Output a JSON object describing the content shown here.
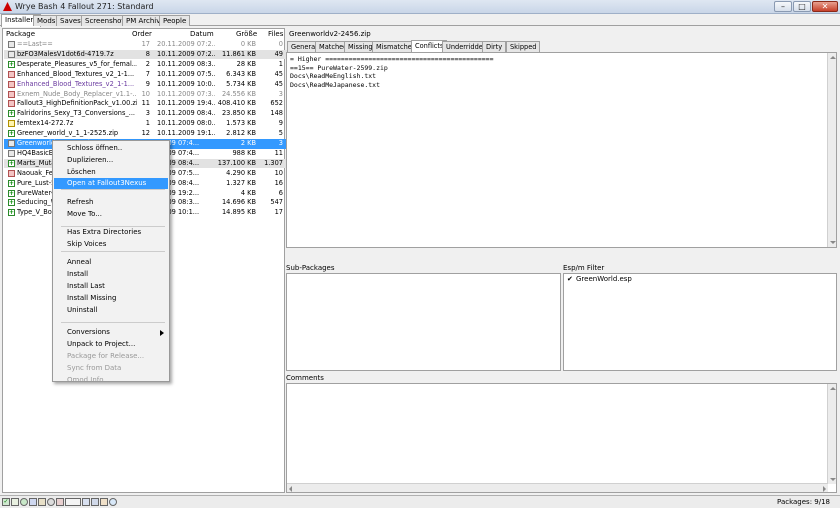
{
  "window": {
    "title": "Wrye Bash 4 Fallout 271: Standard"
  },
  "tabs": [
    "Installers",
    "Mods",
    "Saves",
    "Screenshots",
    "PM Archive",
    "People"
  ],
  "columns": {
    "package": "Package",
    "order": "Order",
    "date": "Datum",
    "size": "Größe",
    "files": "Files"
  },
  "rows": [
    {
      "name": "==Last==",
      "order": "17",
      "date": "20.11.2009 07:2...",
      "size": "0 KB",
      "files": "0",
      "style": "gray",
      "box": "gray"
    },
    {
      "name": "bzFO3MalesV1dot6d-4719.7z",
      "order": "8",
      "date": "10.11.2009 07:2...",
      "size": "11.861 KB",
      "files": "49",
      "style": "grayBg",
      "box": "gray"
    },
    {
      "name": "Desperate_Pleasures_v5_for_femal...",
      "order": "2",
      "date": "10.11.2009 08:3...",
      "size": "28 KB",
      "files": "1",
      "style": "",
      "box": "plus"
    },
    {
      "name": "Enhanced_Blood_Textures_v2_1-1...",
      "order": "7",
      "date": "10.11.2009 07:5...",
      "size": "6.343 KB",
      "files": "45",
      "style": "",
      "box": "red"
    },
    {
      "name": "Enhanced_Blood_Textures_v2_1-1...",
      "order": "9",
      "date": "10.11.2009 10:0...",
      "size": "5.734 KB",
      "files": "45",
      "style": "purple",
      "box": "red"
    },
    {
      "name": "Exnem_Nude_Body_Replacer_v1.1-...",
      "order": "10",
      "date": "10.11.2009 07:3...",
      "size": "24.556 KB",
      "files": "3",
      "style": "gray",
      "box": "red"
    },
    {
      "name": "Fallout3_HighDefinitionPack_v1.00.zip",
      "order": "11",
      "date": "10.11.2009 19:4...",
      "size": "408.410 KB",
      "files": "652",
      "style": "",
      "box": "red"
    },
    {
      "name": "Falridorins_Sexy_T3_Conversions_...",
      "order": "3",
      "date": "10.11.2009 08:4...",
      "size": "23.850 KB",
      "files": "148",
      "style": "",
      "box": "plus"
    },
    {
      "name": "femtex14-272.7z",
      "order": "1",
      "date": "10.11.2009 08:0...",
      "size": "1.573 KB",
      "files": "9",
      "style": "",
      "box": "yel"
    },
    {
      "name": "Greener_world_v_1_1-2525.zip",
      "order": "12",
      "date": "10.11.2009 19:1...",
      "size": "2.812 KB",
      "files": "5",
      "style": "",
      "box": "plus"
    },
    {
      "name": "Greenworldv2-2456.zip",
      "order": "",
      "date": ".2009 07:4...",
      "size": "2 KB",
      "files": "3",
      "style": "selected",
      "box": "gray"
    },
    {
      "name": "HQ4BasicEyes",
      "order": "",
      "date": ".2009 07:4...",
      "size": "988 KB",
      "files": "11",
      "style": "",
      "box": "gray"
    },
    {
      "name": "Marts_Mutant",
      "order": "",
      "date": ".2009 08:4...",
      "size": "137.100 KB",
      "files": "1.307",
      "style": "grayBg",
      "box": "plus"
    },
    {
      "name": "Naouak_Fema",
      "order": "",
      "date": ".2009 07:5...",
      "size": "4.290 KB",
      "files": "10",
      "style": "",
      "box": "red"
    },
    {
      "name": "Pure_Lust-57",
      "order": "",
      "date": ".2009 08:4...",
      "size": "1.327 KB",
      "files": "16",
      "style": "",
      "box": "plus"
    },
    {
      "name": "PureWater-25",
      "order": "",
      "date": ".2009 19:2...",
      "size": "4 KB",
      "files": "6",
      "style": "",
      "box": "plus"
    },
    {
      "name": "Seducing_Wo",
      "order": "",
      "date": ".2009 08:3...",
      "size": "14.696 KB",
      "files": "547",
      "style": "",
      "box": "plus"
    },
    {
      "name": "Type_V_Body",
      "order": "",
      "date": ".2009 10:1...",
      "size": "14.895 KB",
      "files": "17",
      "style": "",
      "box": "plus"
    }
  ],
  "context_menu": {
    "items": [
      {
        "label": "Schloss öffnen..",
        "state": ""
      },
      {
        "label": "Duplizieren...",
        "state": ""
      },
      {
        "label": "Löschen",
        "state": ""
      },
      {
        "label": "Open at Fallout3Nexus",
        "state": "hl"
      },
      {
        "label": "Refresh",
        "state": ""
      },
      {
        "label": "Move To...",
        "state": ""
      },
      {
        "label": "Has Extra Directories",
        "state": ""
      },
      {
        "label": "Skip Voices",
        "state": ""
      },
      {
        "label": "Anneal",
        "state": ""
      },
      {
        "label": "Install",
        "state": ""
      },
      {
        "label": "Install Last",
        "state": ""
      },
      {
        "label": "Install Missing",
        "state": ""
      },
      {
        "label": "Uninstall",
        "state": ""
      },
      {
        "label": "Conversions",
        "state": "sub"
      },
      {
        "label": "Unpack to Project...",
        "state": ""
      },
      {
        "label": "Package for Release...",
        "state": "dis"
      },
      {
        "label": "Sync from Data",
        "state": "dis"
      },
      {
        "label": "Omod Info...",
        "state": "dis"
      }
    ]
  },
  "details": {
    "package_name": "Greenworldv2-2456.zip",
    "tabs": [
      "General",
      "Matched",
      "Missing",
      "Mismatched",
      "Conflicts",
      "Underridden",
      "Dirty",
      "Skipped"
    ],
    "conflicts_text": "= Higher ===========================================\n==15== PureWater-2599.zip\nDocs\\ReadMeEnglish.txt\nDocs\\ReadMeJapanese.txt",
    "subpackages_label": "Sub-Packages",
    "espm_label": "Esp/m Filter",
    "espm_items": [
      {
        "checked": true,
        "name": "GreenWorld.esp"
      }
    ],
    "comments_label": "Comments"
  },
  "status": {
    "packages": "Packages: 9/18"
  }
}
